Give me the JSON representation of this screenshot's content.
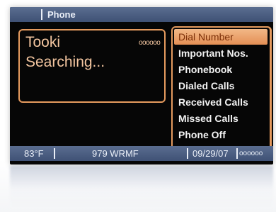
{
  "header": {
    "title": "Phone"
  },
  "call_panel": {
    "caller": "Tooki",
    "status": "Searching...",
    "signal": "oooooo"
  },
  "menu": {
    "items": [
      {
        "label": "Dial Number",
        "selected": true
      },
      {
        "label": "Important Nos.",
        "selected": false
      },
      {
        "label": "Phonebook",
        "selected": false
      },
      {
        "label": "Dialed Calls",
        "selected": false
      },
      {
        "label": "Received Calls",
        "selected": false
      },
      {
        "label": "Missed Calls",
        "selected": false
      },
      {
        "label": "Phone Off",
        "selected": false
      }
    ]
  },
  "status_bar": {
    "temperature": "83°F",
    "radio_station": "979 WRMF",
    "date": "09/29/07",
    "signal": "oooooo"
  },
  "colors": {
    "bar": "#4a5d82",
    "accent_border": "#e59a5e",
    "selected_bg": "#eca06a",
    "text_light": "#f3f3f3",
    "screen_bg": "#060606"
  }
}
